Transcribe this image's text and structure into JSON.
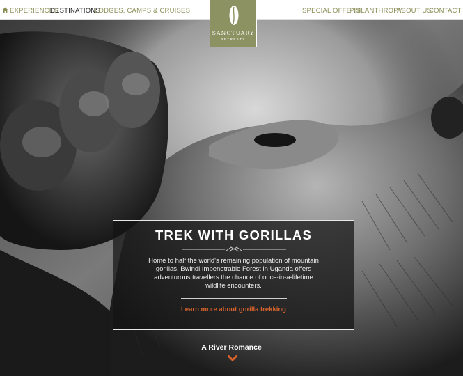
{
  "nav": {
    "left_items": [
      {
        "label": "Experiences",
        "active": false
      },
      {
        "label": "Destinations",
        "active": true
      },
      {
        "label": "Lodges, Camps & Cruises",
        "active": false
      }
    ],
    "right_items": [
      {
        "label": "Special Offers"
      },
      {
        "label": "Philanthropy"
      },
      {
        "label": "About Us"
      },
      {
        "label": "Contact Us"
      }
    ],
    "home_icon": "home-icon"
  },
  "logo": {
    "word": "SANCTUARY",
    "sub": "RETREATS",
    "bg_color": "#8c9262"
  },
  "hero": {
    "image": "black-and-white close-up gorilla",
    "panel": {
      "title": "TREK WITH GORILLAS",
      "body": "Home to half the world's remaining population of mountain gorillas, Bwindi Impenetrable Forest in Uganda offers adventurous travellers the chance of once-in-a-lifetime wildlife encounters.",
      "link": "Learn more about gorilla trekking",
      "link_color": "#d8632c"
    },
    "next": {
      "label": "A River Romance",
      "icon": "chevron-down-icon"
    }
  },
  "colors": {
    "nav_text": "#8b8f57",
    "nav_active": "#1e1e1e"
  }
}
